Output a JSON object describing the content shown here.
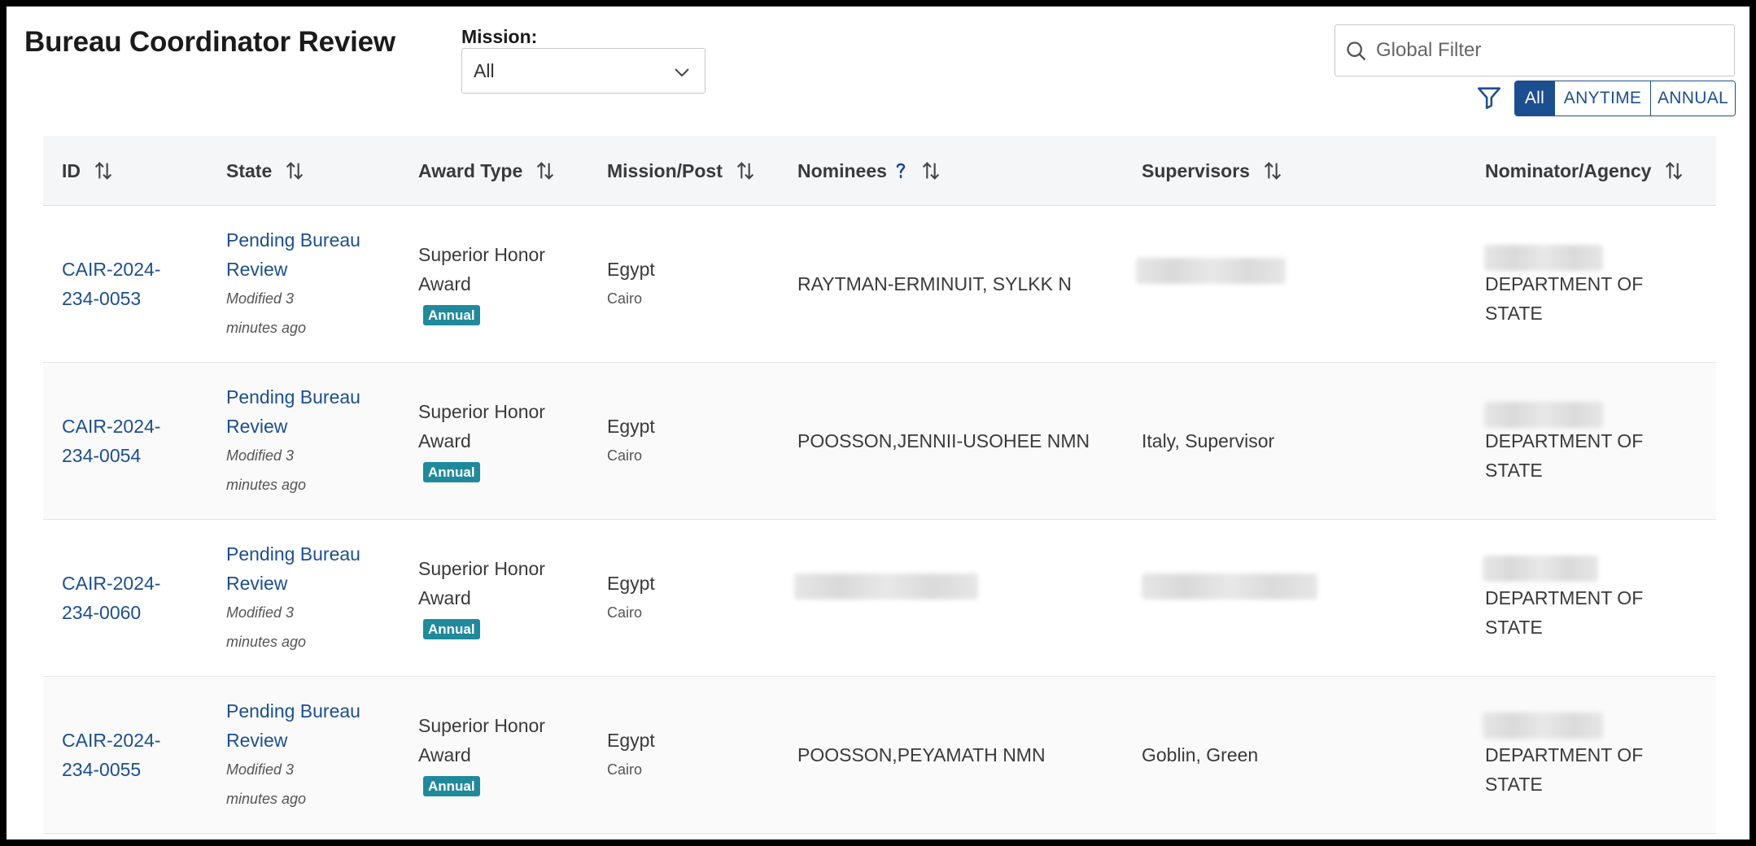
{
  "page": {
    "title": "Bureau Coordinator Review"
  },
  "mission": {
    "label": "Mission:",
    "value": "All"
  },
  "search": {
    "placeholder": "Global Filter"
  },
  "filter_tabs": [
    "All",
    "ANYTIME",
    "ANNUAL"
  ],
  "columns": [
    "ID",
    "State",
    "Award Type",
    "Mission/Post",
    "Nominees",
    "Supervisors",
    "Nominator/Agency"
  ],
  "rows": [
    {
      "id_line1": "CAIR-2024-",
      "id_line2": "234-0053",
      "state_line1": "Pending Bureau",
      "state_line2": "Review",
      "modified_line1": "Modified 3",
      "modified_line2": "minutes ago",
      "award_line1": "Superior Honor",
      "award_line2": "Award",
      "badge": "Annual",
      "mission": "Egypt",
      "post": "Cairo",
      "nominee": "RAYTMAN-ERMINUIT, SYLKK N",
      "supervisor": "",
      "agency_line1": "DEPARTMENT OF",
      "agency_line2": "STATE"
    },
    {
      "id_line1": "CAIR-2024-",
      "id_line2": "234-0054",
      "state_line1": "Pending Bureau",
      "state_line2": "Review",
      "modified_line1": "Modified 3",
      "modified_line2": "minutes ago",
      "award_line1": "Superior Honor",
      "award_line2": "Award",
      "badge": "Annual",
      "mission": "Egypt",
      "post": "Cairo",
      "nominee": "POOSSON,JENNII-USOHEE NMN",
      "supervisor": "Italy, Supervisor",
      "agency_line1": "DEPARTMENT OF",
      "agency_line2": "STATE"
    },
    {
      "id_line1": "CAIR-2024-",
      "id_line2": "234-0060",
      "state_line1": "Pending Bureau",
      "state_line2": "Review",
      "modified_line1": "Modified 3",
      "modified_line2": "minutes ago",
      "award_line1": "Superior Honor",
      "award_line2": "Award",
      "badge": "Annual",
      "mission": "Egypt",
      "post": "Cairo",
      "nominee": "",
      "supervisor": "",
      "agency_line1": "DEPARTMENT OF",
      "agency_line2": "STATE"
    },
    {
      "id_line1": "CAIR-2024-",
      "id_line2": "234-0055",
      "state_line1": "Pending Bureau",
      "state_line2": "Review",
      "modified_line1": "Modified 3",
      "modified_line2": "minutes ago",
      "award_line1": "Superior Honor",
      "award_line2": "Award",
      "badge": "Annual",
      "mission": "Egypt",
      "post": "Cairo",
      "nominee": "POOSSON,PEYAMATH NMN",
      "supervisor": "Goblin, Green",
      "agency_line1": "DEPARTMENT OF",
      "agency_line2": "STATE"
    }
  ],
  "colors": {
    "primary": "#1c4f8f",
    "badge": "#1f8a9c",
    "header_bg": "#f5f6f7"
  },
  "icons": {
    "search": "search-icon",
    "filter": "filter-icon",
    "sort": "sort-icon",
    "help": "help-icon",
    "dropdown": "chevron-down-icon"
  }
}
